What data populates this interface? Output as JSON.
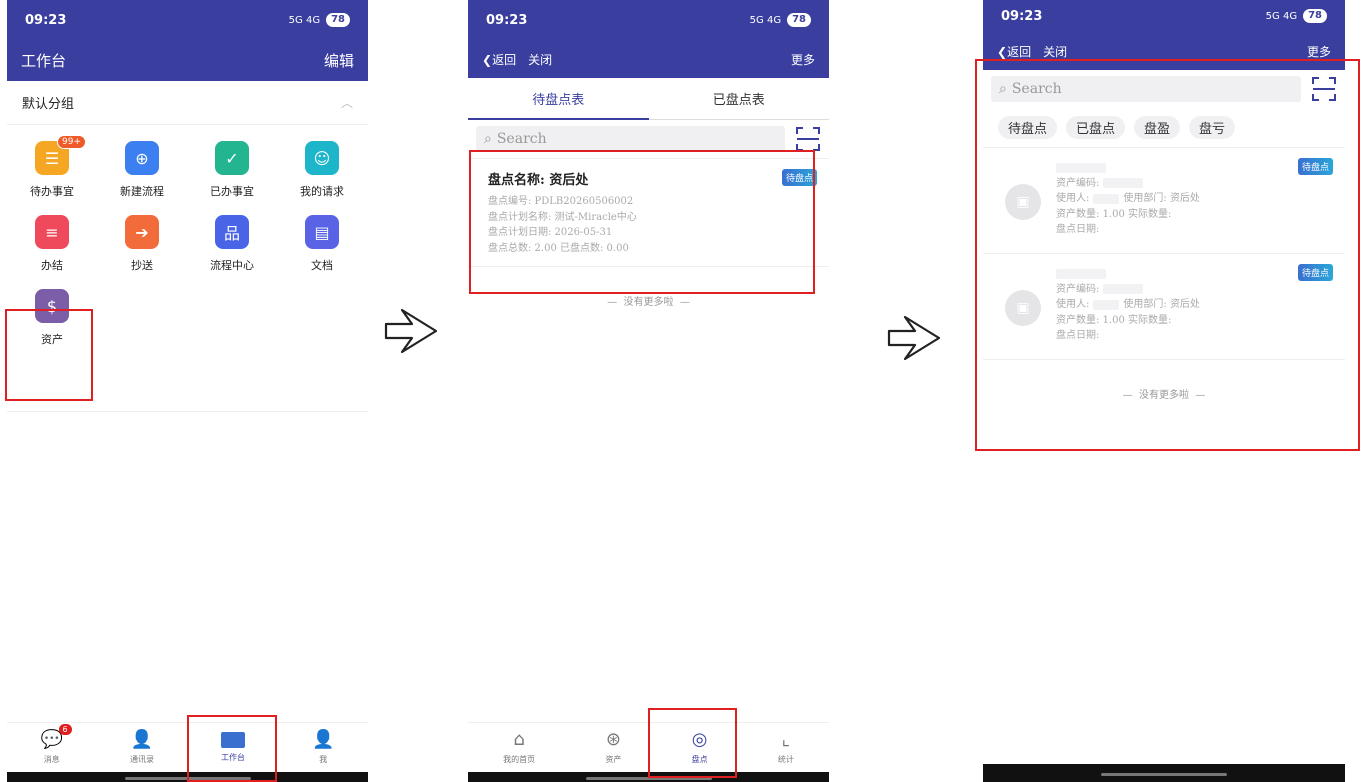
{
  "status": {
    "time": "09:23",
    "battery": "78",
    "signal": "5G 4G"
  },
  "phone1": {
    "title": "工作台",
    "edit": "编辑",
    "group": "默认分组",
    "apps": [
      {
        "label": "待办事宜",
        "badge": "99+",
        "color": "#f5a623",
        "icon": "todo-icon"
      },
      {
        "label": "新建流程",
        "color": "#3b7ff0",
        "icon": "new-flow-icon"
      },
      {
        "label": "已办事宜",
        "color": "#22b58f",
        "icon": "done-icon"
      },
      {
        "label": "我的请求",
        "color": "#1cb5c9",
        "icon": "request-icon"
      },
      {
        "label": "办结",
        "color": "#ef4a5c",
        "icon": "finished-icon"
      },
      {
        "label": "抄送",
        "color": "#f26b3a",
        "icon": "cc-icon"
      },
      {
        "label": "流程中心",
        "color": "#4a64e8",
        "icon": "flow-center-icon"
      },
      {
        "label": "文档",
        "color": "#5a63e6",
        "icon": "document-icon"
      },
      {
        "label": "资产",
        "color": "#7b5ea7",
        "icon": "asset-icon"
      }
    ],
    "tabs": [
      {
        "label": "消息",
        "badge": "6"
      },
      {
        "label": "通讯录"
      },
      {
        "label": "工作台"
      },
      {
        "label": "我"
      }
    ]
  },
  "phone2": {
    "back": "返回",
    "close": "关闭",
    "more": "更多",
    "subtabs": [
      "待盘点表",
      "已盘点表"
    ],
    "search_placeholder": "Search",
    "card": {
      "title": "盘点名称: 资后处",
      "tag": "待盘点",
      "lines": [
        "盘点编号: PDLB20260506002",
        "盘点计划名称: 测试-Miracle中心",
        "盘点计划日期: 2026-05-31",
        "盘点总数: 2.00  已盘点数: 0.00"
      ]
    },
    "no_more": "没有更多啦",
    "tabs": [
      {
        "label": "我的首页"
      },
      {
        "label": "资产"
      },
      {
        "label": "盘点"
      },
      {
        "label": "统计"
      }
    ]
  },
  "phone3": {
    "back": "返回",
    "close": "关闭",
    "more": "更多",
    "search_placeholder": "Search",
    "chips": [
      "待盘点",
      "已盘点",
      "盘盈",
      "盘亏"
    ],
    "assets": [
      {
        "tag": "待盘点",
        "code_label": "资产编码:",
        "user_label": "使用人:",
        "dept_label": "使用部门:",
        "dept_value": "资后处",
        "qty_label": "资产数量:",
        "qty_value": "1.00",
        "actual_label": "实际数量:",
        "date_label": "盘点日期:"
      },
      {
        "tag": "待盘点",
        "code_label": "资产编码:",
        "user_label": "使用人:",
        "dept_label": "使用部门:",
        "dept_value": "资后处",
        "qty_label": "资产数量:",
        "qty_value": "1.00",
        "actual_label": "实际数量:",
        "date_label": "盘点日期:"
      }
    ],
    "no_more": "没有更多啦"
  }
}
